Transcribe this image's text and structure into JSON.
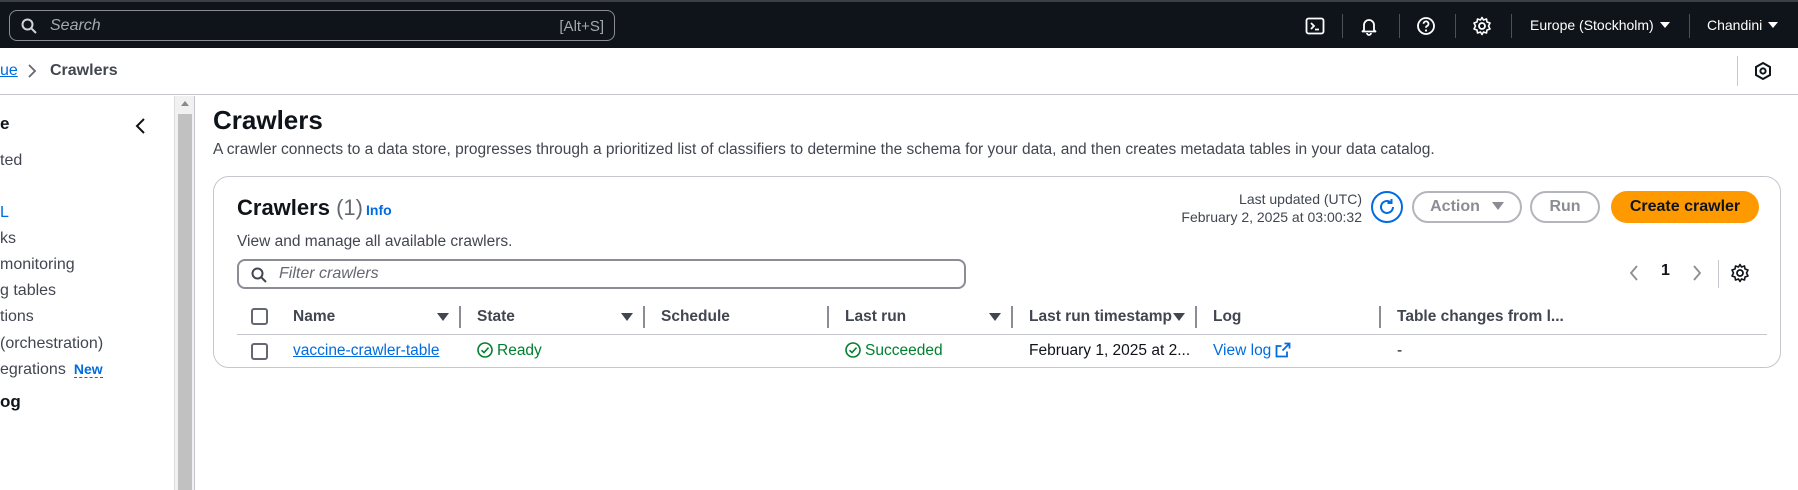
{
  "topbar": {
    "search_placeholder": "Search",
    "search_shortcut": "[Alt+S]",
    "region": "Europe (Stockholm)",
    "user": "Chandini",
    "icons": [
      "cloudshell-icon",
      "bell-icon",
      "help-icon",
      "gear-icon"
    ]
  },
  "breadcrumb": {
    "parent": "ue",
    "current": "Crawlers"
  },
  "sidenav": {
    "items": [
      {
        "label": "e",
        "bold": true
      },
      {
        "label": "ted"
      },
      {
        "label": "L"
      },
      {
        "label": "ks"
      },
      {
        "label": "monitoring"
      },
      {
        "label": "g tables"
      },
      {
        "label": "tions"
      },
      {
        "label": "(orchestration)"
      },
      {
        "label": "egrations",
        "badge": "New"
      },
      {
        "label": "og",
        "bold": true
      }
    ]
  },
  "page": {
    "title": "Crawlers",
    "description": "A crawler connects to a data store, progresses through a prioritized list of classifiers to determine the schema for your data, and then creates metadata tables in your data catalog."
  },
  "panel": {
    "title": "Crawlers",
    "count": "(1)",
    "info": "Info",
    "description": "View and manage all available crawlers.",
    "last_updated_label": "Last updated (UTC)",
    "last_updated_value": "February 2, 2025 at 03:00:32",
    "action_label": "Action",
    "run_label": "Run",
    "create_label": "Create crawler",
    "filter_placeholder": "Filter crawlers",
    "page_number": "1"
  },
  "table": {
    "headers": {
      "name": "Name",
      "state": "State",
      "schedule": "Schedule",
      "last_run": "Last run",
      "last_run_timestamp": "Last run timestamp",
      "log": "Log",
      "table_changes": "Table changes from l..."
    },
    "rows": [
      {
        "name": "vaccine-crawler-table",
        "state": "Ready",
        "schedule": "",
        "last_run": "Succeeded",
        "last_run_timestamp": "February 1, 2025 at 2...",
        "log": "View log",
        "table_changes": "-"
      }
    ]
  },
  "colors": {
    "topbar_bg": "#0f141a",
    "link": "#006ce0",
    "primary": "#ff9900",
    "success": "#00802f"
  }
}
